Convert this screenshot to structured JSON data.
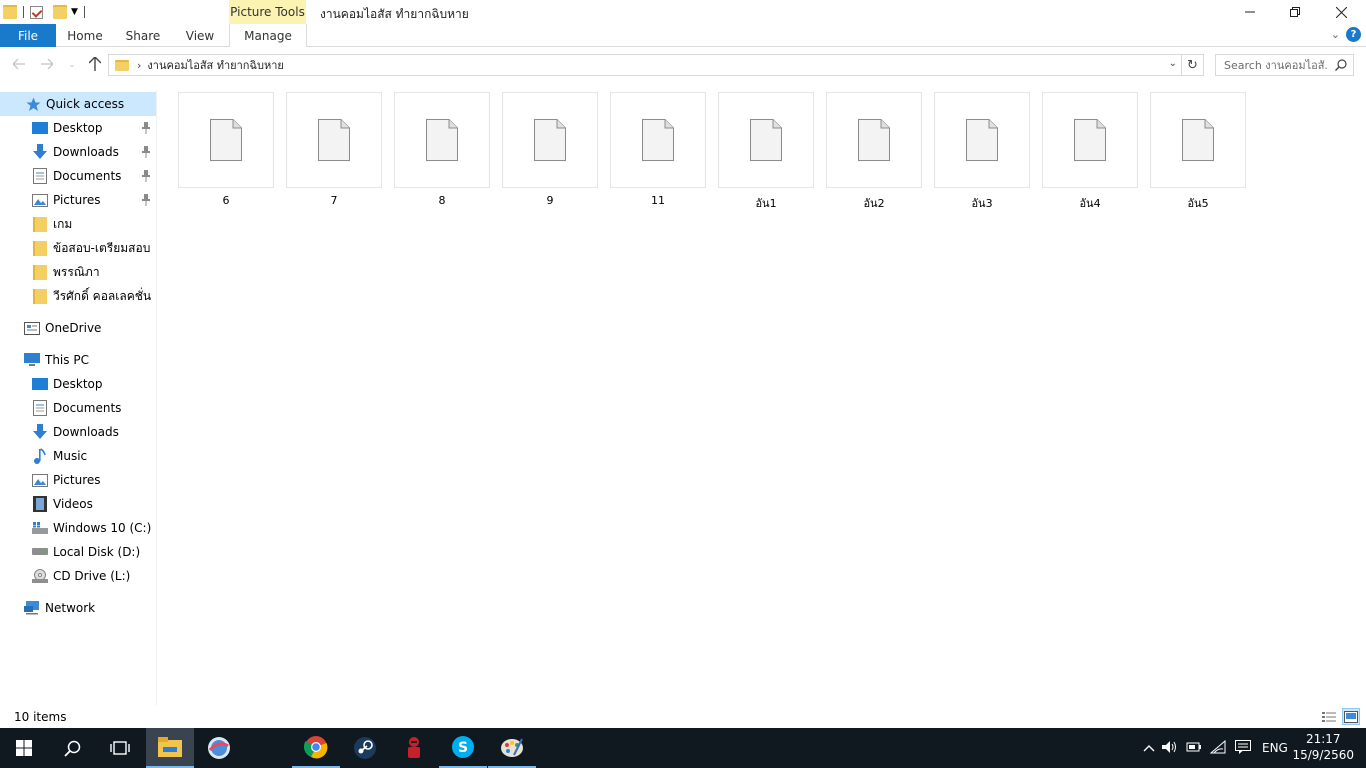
{
  "window": {
    "title": "งานคอมไอสัส ทำยากฉิบหาย",
    "contextual_tab": "Picture Tools"
  },
  "ribbon": {
    "file": "File",
    "tabs": [
      "Home",
      "Share",
      "View",
      "Manage"
    ]
  },
  "address": {
    "path": "งานคอมไอสัส ทำยากฉิบหาย",
    "search_placeholder": "Search งานคอมไอสั..."
  },
  "sidebar": {
    "quick_access": "Quick access",
    "quick_items": [
      {
        "label": "Desktop",
        "icon": "desktop-icon",
        "pinned": true
      },
      {
        "label": "Downloads",
        "icon": "downloads-icon",
        "pinned": true
      },
      {
        "label": "Documents",
        "icon": "documents-icon",
        "pinned": true
      },
      {
        "label": "Pictures",
        "icon": "pictures-icon",
        "pinned": true
      },
      {
        "label": "เกม",
        "icon": "folder-icon",
        "pinned": false
      },
      {
        "label": "ข้อสอบ-เตรียมสอบ",
        "icon": "folder-icon",
        "pinned": false
      },
      {
        "label": "พรรณิภา",
        "icon": "folder-icon",
        "pinned": false
      },
      {
        "label": "วีรศักดิ์ คอลเลคชั่น",
        "icon": "folder-icon",
        "pinned": false
      }
    ],
    "onedrive": "OneDrive",
    "this_pc": "This PC",
    "pc_items": [
      {
        "label": "Desktop",
        "icon": "desktop-icon"
      },
      {
        "label": "Documents",
        "icon": "documents-icon"
      },
      {
        "label": "Downloads",
        "icon": "downloads-icon"
      },
      {
        "label": "Music",
        "icon": "music-icon"
      },
      {
        "label": "Pictures",
        "icon": "pictures-icon"
      },
      {
        "label": "Videos",
        "icon": "videos-icon"
      },
      {
        "label": "Windows 10 (C:)",
        "icon": "windows-drive-icon"
      },
      {
        "label": "Local Disk (D:)",
        "icon": "disk-icon"
      },
      {
        "label": "CD Drive (L:)",
        "icon": "cd-drive-icon"
      }
    ],
    "network": "Network"
  },
  "files": [
    "6",
    "7",
    "8",
    "9",
    "11",
    "อัน1",
    "อัน2",
    "อัน3",
    "อัน4",
    "อัน5"
  ],
  "status": {
    "count": "10 items"
  },
  "taskbar": {
    "language": "ENG",
    "time": "21:17",
    "date": "15/9/2560"
  },
  "colors": {
    "accent": "#1979ca",
    "selection": "#cce8ff",
    "contextual_tab_bg": "#fbf3b2",
    "taskbar": "#101820"
  }
}
